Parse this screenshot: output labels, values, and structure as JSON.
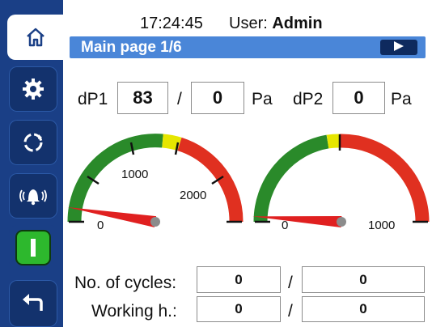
{
  "header": {
    "time": "17:24:45",
    "user_label": "User:",
    "user_name": "Admin"
  },
  "page": {
    "title": "Main page 1/6"
  },
  "sidebar": {
    "items": [
      {
        "name": "home",
        "icon": "home-icon"
      },
      {
        "name": "settings",
        "icon": "gear-icon"
      },
      {
        "name": "cycle",
        "icon": "refresh-icon"
      },
      {
        "name": "alarms",
        "icon": "alarm-bell-icon"
      },
      {
        "name": "start",
        "icon": "power-on-icon"
      },
      {
        "name": "back",
        "icon": "back-arrow-icon"
      }
    ]
  },
  "pressures": {
    "dp1_label": "dP1",
    "dp1_value": "83",
    "dp1_setpoint": "0",
    "separator": "/",
    "unit": "Pa",
    "dp2_label": "dP2",
    "dp2_value": "0",
    "dp2_unit": "Pa"
  },
  "gauges": {
    "left": {
      "ticks": [
        "0",
        "1000",
        "2000"
      ],
      "needle_value": 83,
      "max": 2500
    },
    "right": {
      "ticks": [
        "0",
        "1000"
      ],
      "needle_value": 0,
      "max": 1000
    }
  },
  "counters": {
    "cycles_label": "No. of cycles:",
    "cycles_value": "0",
    "cycles_total": "0",
    "hours_label": "Working h.:",
    "hours_value": "0",
    "hours_total": "0",
    "separator": "/"
  },
  "colors": {
    "sidebar": "#1a3f86",
    "title_bar": "#4a86d8",
    "green": "#2a8a2a",
    "yellow": "#e6e600",
    "red": "#e03020",
    "needle": "#e02020"
  }
}
